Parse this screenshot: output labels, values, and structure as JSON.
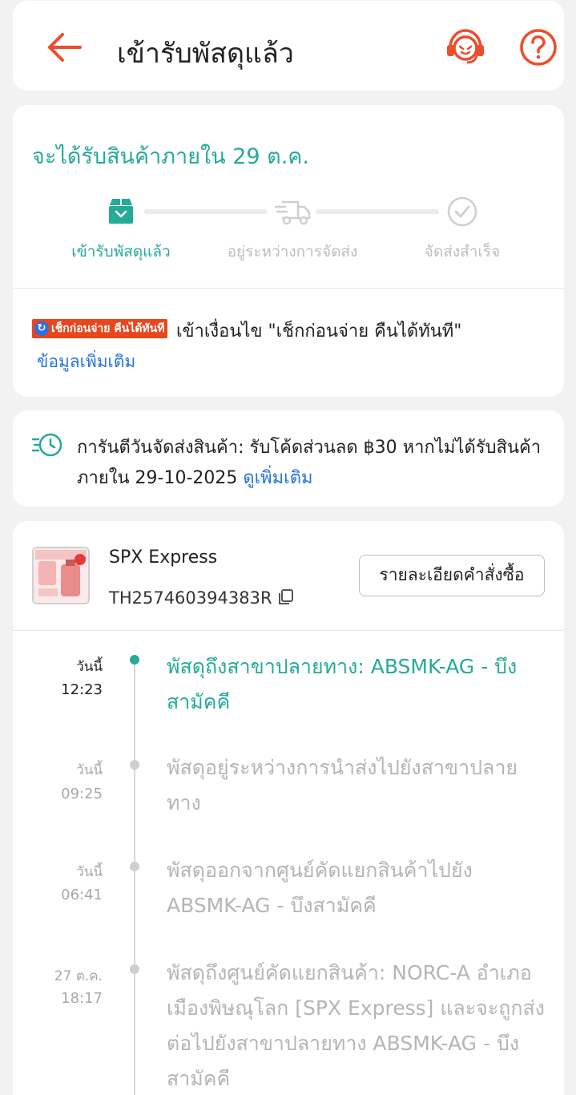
{
  "header": {
    "title": "เข้ารับพัสดุแล้ว"
  },
  "delivery": {
    "eta": "จะได้รับสินค้าภายใน 29 ต.ค.",
    "steps": [
      {
        "label": "เข้ารับพัสดุแล้ว",
        "icon": "package-icon",
        "active": true
      },
      {
        "label": "อยู่ระหว่างการจัดส่ง",
        "icon": "truck-icon",
        "active": false
      },
      {
        "label": "จัดส่งสำเร็จ",
        "icon": "check-circle-icon",
        "active": false
      }
    ],
    "cod_badge": "เช็กก่อนจ่าย คืนได้ทันที",
    "cod_text": "เข้าเงื่อนไข \"เช็กก่อนจ่าย คืนได้ทันที\"",
    "more_info": "ข้อมูลเพิ่มเติม"
  },
  "guarantee": {
    "text": "การันตีวันจัดส่งสินค้า: รับโค้ดส่วนลด ฿30 หากไม่ได้รับสินค้าภายใน 29-10-2025 ",
    "link": "ดูเพิ่มเติม"
  },
  "shipment": {
    "carrier": "SPX Express",
    "tracking_number": "TH257460394383R",
    "order_details_button": "รายละเอียดคำสั่งซื้อ"
  },
  "timeline": [
    {
      "day": "วันนี้",
      "time": "12:23",
      "desc": "พัสดุถึงสาขาปลายทาง: ABSMK-AG - บึงสามัคคี",
      "active": true
    },
    {
      "day": "วันนี้",
      "time": "09:25",
      "desc": "พัสดุอยู่ระหว่างการนำส่งไปยังสาขาปลายทาง",
      "active": false
    },
    {
      "day": "วันนี้",
      "time": "06:41",
      "desc": "พัสดุออกจากศูนย์คัดแยกสินค้าไปยัง ABSMK-AG - บึงสามัคคี",
      "active": false
    },
    {
      "day": "27 ต.ค.",
      "time": "18:17",
      "desc": "พัสดุถึงศูนย์คัดแยกสินค้า: NORC-A อำเภอเมืองพิษณุโลก [SPX Express] และจะถูกส่งต่อไปยังสาขาปลายทาง ABSMK-AG - บึงสามัคคี",
      "active": false
    }
  ],
  "colors": {
    "accent_orange": "#ee4d2d",
    "accent_teal": "#26aa99",
    "link_blue": "#2673dd"
  }
}
